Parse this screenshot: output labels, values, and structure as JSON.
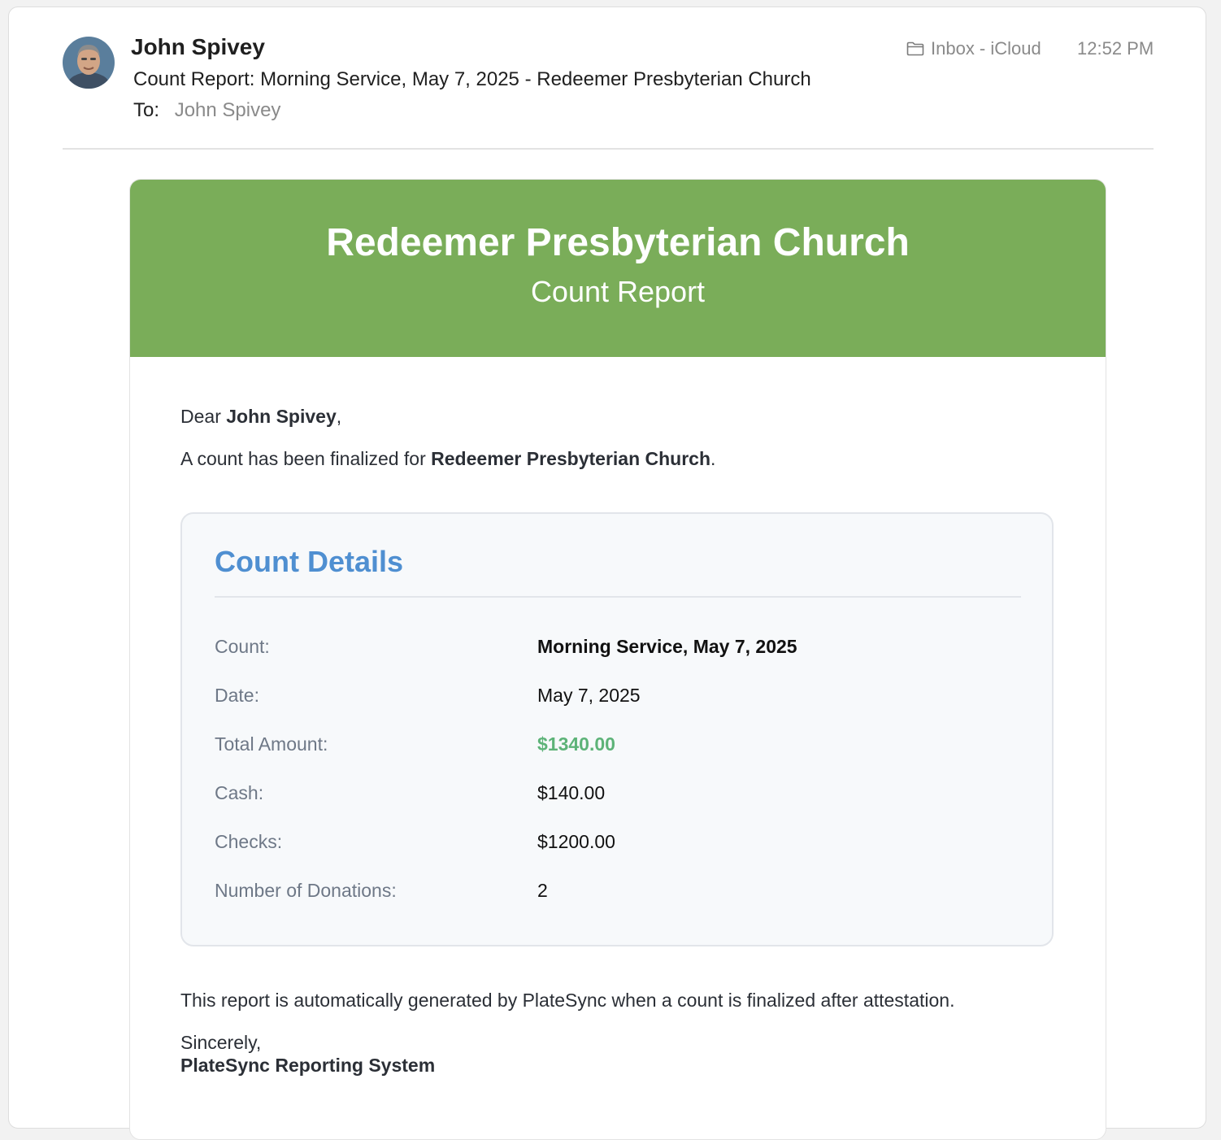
{
  "header": {
    "sender_name": "John Spivey",
    "subject": "Count Report: Morning Service, May 7, 2025 - Redeemer Presbyterian Church",
    "to_label": "To:",
    "to_name": "John Spivey",
    "mailbox": "Inbox - iCloud",
    "time": "12:52 PM"
  },
  "email": {
    "banner_title": "Redeemer Presbyterian Church",
    "banner_subtitle": "Count Report",
    "greeting_prefix": "Dear ",
    "greeting_name": "John Spivey",
    "greeting_suffix": ",",
    "intro_prefix": "A count has been finalized for ",
    "intro_church": "Redeemer Presbyterian Church",
    "intro_suffix": ".",
    "details_title": "Count Details",
    "rows": [
      {
        "label": "Count:",
        "value": "Morning Service, May 7, 2025"
      },
      {
        "label": "Date:",
        "value": "May 7, 2025"
      },
      {
        "label": "Total Amount:",
        "value": "$1340.00"
      },
      {
        "label": "Cash:",
        "value": "$140.00"
      },
      {
        "label": "Checks:",
        "value": "$1200.00"
      },
      {
        "label": "Number of Donations:",
        "value": "2"
      }
    ],
    "footer_note": "This report is automatically generated by PlateSync when a count is finalized after attestation.",
    "sign_off": "Sincerely,",
    "signature": "PlateSync Reporting System"
  },
  "colors": {
    "banner": "#7aad59",
    "details_title": "#4f8fd1",
    "total_amount": "#5db378"
  },
  "icons": {
    "mailbox": "folder-icon",
    "avatar": "avatar"
  }
}
